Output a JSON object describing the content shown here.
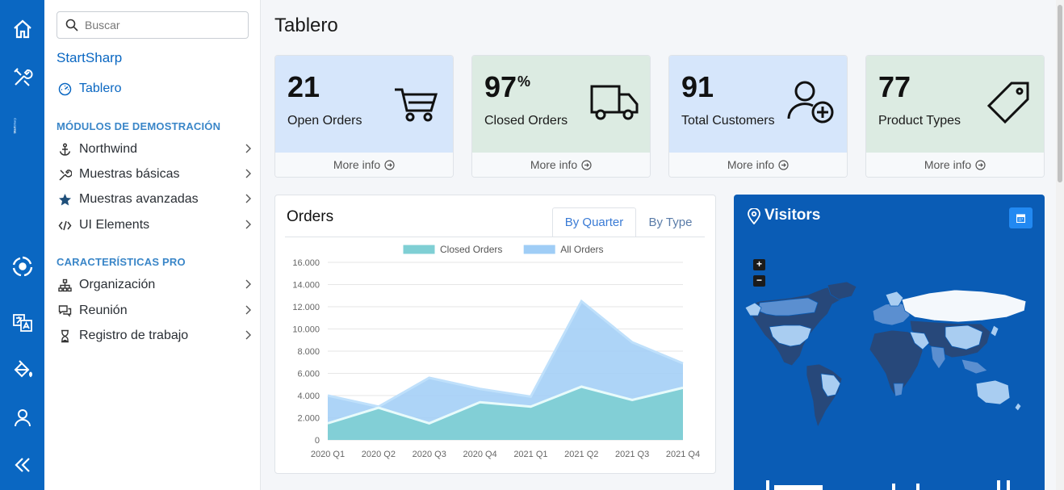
{
  "rail": {
    "icons": [
      "home-icon",
      "tools-icon",
      "translate-icon",
      "paint-bucket-icon",
      "user-icon",
      "collapse-icon"
    ],
    "brand_text": "StartSharp"
  },
  "sidebar": {
    "search_placeholder": "Buscar",
    "title": "StartSharp",
    "dashboard": "Tablero",
    "section_demo": "MÓDULOS DE DEMOSTRACIÓN",
    "demo_items": [
      {
        "label": "Northwind",
        "icon": "anchor-icon"
      },
      {
        "label": "Muestras básicas",
        "icon": "wrench-icon"
      },
      {
        "label": "Muestras avanzadas",
        "icon": "star-icon"
      },
      {
        "label": "UI Elements",
        "icon": "code-icon"
      }
    ],
    "section_pro": "CARACTERÍSTICAS PRO",
    "pro_items": [
      {
        "label": "Organización",
        "icon": "sitemap-icon"
      },
      {
        "label": "Reunión",
        "icon": "comments-icon"
      },
      {
        "label": "Registro de trabajo",
        "icon": "hourglass-icon"
      }
    ]
  },
  "main": {
    "title": "Tablero",
    "boxes": [
      {
        "value": "21",
        "suffix": "",
        "label": "Open Orders",
        "more": "More info",
        "color": "#d6e6fb",
        "icon": "cart-icon"
      },
      {
        "value": "97",
        "suffix": "%",
        "label": "Closed Orders",
        "more": "More info",
        "color": "#dcebe2",
        "icon": "truck-icon"
      },
      {
        "value": "91",
        "suffix": "",
        "label": "Total Customers",
        "more": "More info",
        "color": "#d6e6fb",
        "icon": "user-plus-icon"
      },
      {
        "value": "77",
        "suffix": "",
        "label": "Product Types",
        "more": "More info",
        "color": "#dcebe2",
        "icon": "tag-icon"
      }
    ]
  },
  "orders": {
    "title": "Orders",
    "tabs": [
      "By Quarter",
      "By Type"
    ],
    "active_tab": "By Quarter"
  },
  "chart_data": {
    "type": "area",
    "categories": [
      "2020 Q1",
      "2020 Q2",
      "2020 Q3",
      "2020 Q4",
      "2021 Q1",
      "2021 Q2",
      "2021 Q3",
      "2021 Q4"
    ],
    "series": [
      {
        "name": "Closed Orders",
        "values": [
          1500,
          2900,
          1500,
          3400,
          3000,
          4800,
          3600,
          4700
        ],
        "color": "#7fcfd4"
      },
      {
        "name": "All Orders",
        "values": [
          4000,
          3000,
          5600,
          4600,
          3900,
          12500,
          8800,
          6900
        ],
        "color": "#9fcdf6"
      }
    ],
    "yticks": [
      "0",
      "2.000",
      "4.000",
      "6.000",
      "8.000",
      "10.000",
      "12.000",
      "14.000",
      "16.000"
    ],
    "ylim": [
      0,
      16000
    ],
    "legend_position": "top",
    "grid": true
  },
  "visitors": {
    "title": "Visitors",
    "zoom_in": "+",
    "zoom_out": "−",
    "colors": {
      "bg": "#0a5cb5",
      "land_dark": "#27487a",
      "land_mid": "#5b8fd0",
      "land_light": "#a9cdf1",
      "land_white": "#f4f8fc"
    }
  }
}
